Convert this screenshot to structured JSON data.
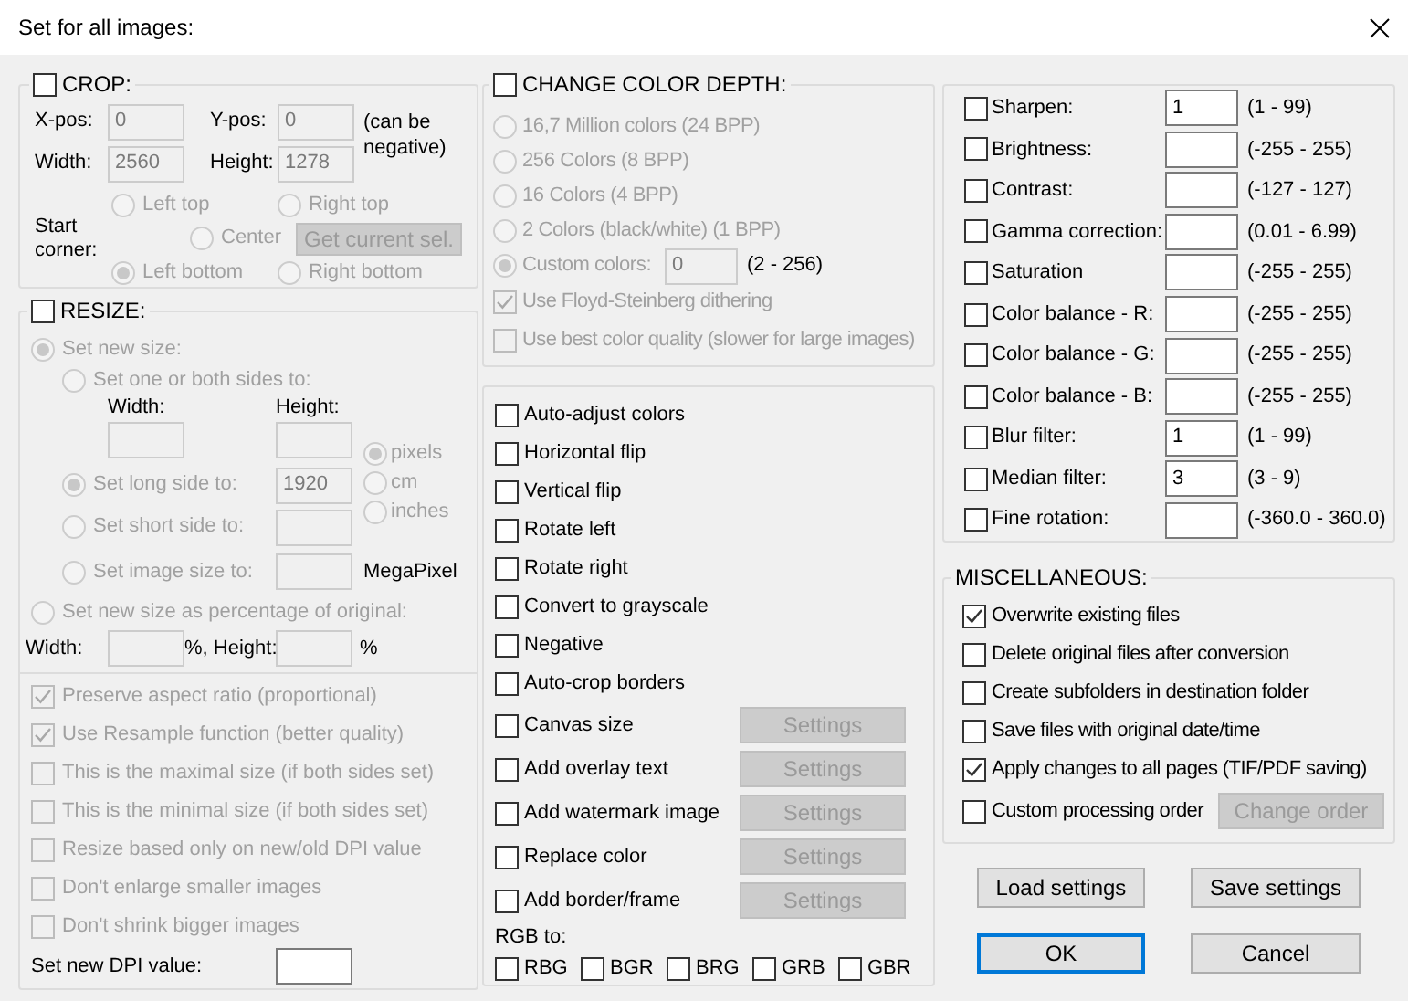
{
  "window": {
    "title": "Set for all images:"
  },
  "crop": {
    "label": "CROP:",
    "checked": false,
    "disabled": true,
    "x_label": "X-pos:",
    "x_value": "0",
    "y_label": "Y-pos:",
    "y_value": "0",
    "note": "(can be negative)",
    "width_label": "Width:",
    "width_value": "2560",
    "height_label": "Height:",
    "height_value": "1278",
    "corner_label": "Start corner:",
    "corners": [
      {
        "label": "Left top",
        "selected": false
      },
      {
        "label": "Right top",
        "selected": false
      },
      {
        "label": "Center",
        "selected": false
      },
      {
        "label": "Left bottom",
        "selected": true
      },
      {
        "label": "Right bottom",
        "selected": false
      }
    ],
    "selection_button": {
      "label": "Get current sel.",
      "disabled": true
    }
  },
  "resize": {
    "label": "RESIZE:",
    "checked": false,
    "disabled": true,
    "modes": [
      {
        "label": "Set new size:",
        "selected": true
      },
      {
        "label": "Set new size as percentage of original:",
        "selected": false
      }
    ],
    "size_options": [
      {
        "label": "Set one or both sides to:",
        "selected": false
      },
      {
        "label": "Set long side to:",
        "selected": true,
        "value": "1920"
      },
      {
        "label": "Set short side to:",
        "selected": false
      },
      {
        "label": "Set image size to:",
        "selected": false,
        "unit": "MegaPixel"
      }
    ],
    "width_label": "Width:",
    "height_label": "Height:",
    "units": [
      {
        "label": "pixels",
        "selected": true
      },
      {
        "label": "cm",
        "selected": false
      },
      {
        "label": "inches",
        "selected": false
      }
    ],
    "percent_width_label": "Width:",
    "percent_height_label": "%, Height:",
    "percent_suffix": "%",
    "options": [
      {
        "label": "Preserve aspect ratio (proportional)",
        "checked": true
      },
      {
        "label": "Use Resample function (better quality)",
        "checked": true
      },
      {
        "label": "This is the maximal size (if both sides set)",
        "checked": false
      },
      {
        "label": "This is the minimal size (if both sides set)",
        "checked": false
      },
      {
        "label": "Resize based only on new/old DPI value",
        "checked": false
      },
      {
        "label": "Don't enlarge smaller images",
        "checked": false
      },
      {
        "label": "Don't shrink bigger images",
        "checked": false
      }
    ],
    "dpi_label": "Set new DPI value:"
  },
  "color_depth": {
    "label": "CHANGE COLOR DEPTH:",
    "checked": false,
    "disabled": true,
    "options": [
      {
        "label": "16,7 Million colors (24 BPP)",
        "selected": false
      },
      {
        "label": "256 Colors (8 BPP)",
        "selected": false
      },
      {
        "label": "16 Colors (4 BPP)",
        "selected": false
      },
      {
        "label": "2 Colors (black/white) (1 BPP)",
        "selected": false
      },
      {
        "label": "Custom colors:",
        "selected": true,
        "value": "0",
        "range": "(2 - 256)"
      }
    ],
    "checks": [
      {
        "label": "Use Floyd-Steinberg dithering",
        "checked": true
      },
      {
        "label": "Use best color quality (slower for large images)",
        "checked": false
      }
    ]
  },
  "transforms": [
    {
      "label": "Auto-adjust colors",
      "checked": false
    },
    {
      "label": "Horizontal flip",
      "checked": false
    },
    {
      "label": "Vertical flip",
      "checked": false
    },
    {
      "label": "Rotate left",
      "checked": false
    },
    {
      "label": "Rotate right",
      "checked": false
    },
    {
      "label": "Convert to grayscale",
      "checked": false
    },
    {
      "label": "Negative",
      "checked": false
    },
    {
      "label": "Auto-crop borders",
      "checked": false
    },
    {
      "label": "Canvas size",
      "checked": false,
      "button": {
        "label": "Settings",
        "disabled": true
      }
    },
    {
      "label": "Add overlay text",
      "checked": false,
      "button": {
        "label": "Settings",
        "disabled": true
      }
    },
    {
      "label": "Add watermark image",
      "checked": false,
      "button": {
        "label": "Settings",
        "disabled": true
      }
    },
    {
      "label": "Replace color",
      "checked": false,
      "button": {
        "label": "Settings",
        "disabled": true
      }
    },
    {
      "label": "Add border/frame",
      "checked": false,
      "button": {
        "label": "Settings",
        "disabled": true
      }
    }
  ],
  "rgb_label": "RGB to:",
  "rgb": [
    {
      "label": "RBG",
      "checked": false
    },
    {
      "label": "BGR",
      "checked": false
    },
    {
      "label": "BRG",
      "checked": false
    },
    {
      "label": "GRB",
      "checked": false
    },
    {
      "label": "GBR",
      "checked": false
    }
  ],
  "adjustments": [
    {
      "label": "Sharpen:",
      "checked": false,
      "value": "1",
      "range": "(1 - 99)"
    },
    {
      "label": "Brightness:",
      "checked": false,
      "range": "(-255 - 255)"
    },
    {
      "label": "Contrast:",
      "checked": false,
      "range": "(-127 - 127)"
    },
    {
      "label": "Gamma correction:",
      "checked": false,
      "range": "(0.01 - 6.99)"
    },
    {
      "label": "Saturation",
      "checked": false,
      "range": "(-255 - 255)"
    },
    {
      "label": "Color balance - R:",
      "checked": false,
      "range": "(-255 - 255)"
    },
    {
      "label": "Color balance - G:",
      "checked": false,
      "range": "(-255 - 255)"
    },
    {
      "label": "Color balance - B:",
      "checked": false,
      "range": "(-255 - 255)"
    },
    {
      "label": "Blur filter:",
      "checked": false,
      "value": "1",
      "range": "(1 - 99)"
    },
    {
      "label": "Median filter:",
      "checked": false,
      "value": "3",
      "range": "(3 - 9)"
    },
    {
      "label": "Fine rotation:",
      "checked": false,
      "range": "(-360.0 - 360.0)"
    }
  ],
  "misc": {
    "title": "MISCELLANEOUS:",
    "options": [
      {
        "label": "Overwrite existing files",
        "checked": true
      },
      {
        "label": "Delete original files after conversion",
        "checked": false
      },
      {
        "label": "Create subfolders in destination folder",
        "checked": false
      },
      {
        "label": "Save files with original date/time",
        "checked": false
      },
      {
        "label": "Apply changes to all pages (TIF/PDF saving)",
        "checked": true
      },
      {
        "label": "Custom processing order",
        "checked": false,
        "button": {
          "label": "Change order",
          "disabled": true
        }
      }
    ]
  },
  "buttons": [
    {
      "label": "Load settings",
      "default": false
    },
    {
      "label": "Save settings",
      "default": false
    },
    {
      "label": "OK",
      "default": true
    },
    {
      "label": "Cancel",
      "default": false
    }
  ]
}
